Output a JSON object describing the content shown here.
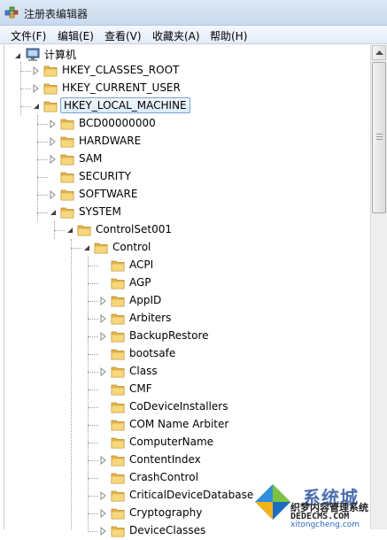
{
  "window": {
    "title": "注册表编辑器"
  },
  "menu": [
    "文件(F)",
    "编辑(E)",
    "查看(V)",
    "收藏夹(A)",
    "帮助(H)"
  ],
  "tree": {
    "root_label": "计算机",
    "hives": [
      "HKEY_CLASSES_ROOT",
      "HKEY_CURRENT_USER",
      "HKEY_LOCAL_MACHINE"
    ],
    "selected_hive": "HKEY_LOCAL_MACHINE",
    "hklm_children": [
      "BCD00000000",
      "HARDWARE",
      "SAM",
      "SECURITY",
      "SOFTWARE",
      "SYSTEM"
    ],
    "system_children": [
      "ControlSet001"
    ],
    "controlset_children": [
      "Control"
    ],
    "control_children": [
      "ACPI",
      "AGP",
      "AppID",
      "Arbiters",
      "BackupRestore",
      "bootsafe",
      "Class",
      "CMF",
      "CoDeviceInstallers",
      "COM Name Arbiter",
      "ComputerName",
      "ContentIndex",
      "CrashControl",
      "CriticalDeviceDatabase",
      "Cryptography",
      "DeviceClasses"
    ]
  },
  "watermark": {
    "brand": "系统城",
    "line1": "织梦内容管理系统",
    "line2": "DEDECMS.COM",
    "url": "xitongcheng.com"
  }
}
